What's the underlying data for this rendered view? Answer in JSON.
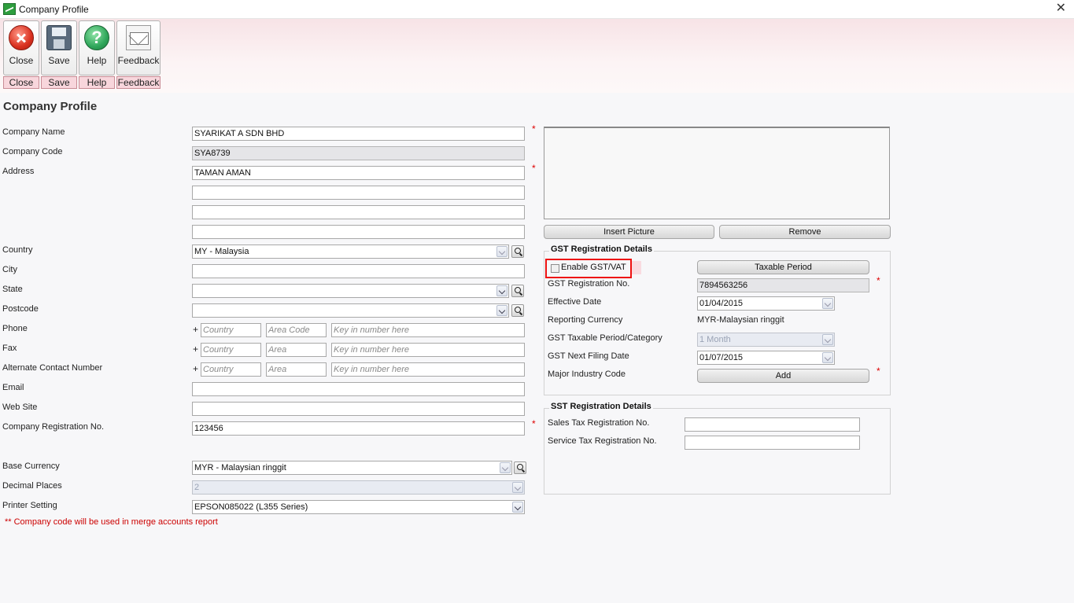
{
  "window": {
    "title": "Company Profile",
    "close_glyph": "✕"
  },
  "toolbar": {
    "buttons": [
      {
        "label": "Close",
        "sub": "Close",
        "icon": "close-icon"
      },
      {
        "label": "Save",
        "sub": "Save",
        "icon": "save-icon"
      },
      {
        "label": "Help",
        "sub": "Help",
        "icon": "help-icon",
        "glyph": "?"
      },
      {
        "label": "Feedback",
        "sub": "Feedback",
        "icon": "feedback-icon"
      }
    ]
  },
  "page_title": "Company Profile",
  "form": {
    "company_name": {
      "label": "Company Name",
      "value": "SYARIKAT A SDN BHD"
    },
    "company_code": {
      "label": "Company Code",
      "value": "SYA8739"
    },
    "address": {
      "label": "Address",
      "line1": "TAMAN AMAN",
      "line2": "",
      "line3": "",
      "line4": ""
    },
    "country": {
      "label": "Country",
      "value": "MY - Malaysia"
    },
    "city": {
      "label": "City",
      "value": ""
    },
    "state": {
      "label": "State",
      "value": ""
    },
    "postcode": {
      "label": "Postcode",
      "value": ""
    },
    "phone": {
      "label": "Phone",
      "plus": "+",
      "country_ph": "Country",
      "area_ph": "Area Code",
      "number_ph": "Key in number here"
    },
    "fax": {
      "label": "Fax",
      "plus": "+",
      "country_ph": "Country",
      "area_ph": "Area",
      "number_ph": "Key in number here"
    },
    "alt_contact": {
      "label": "Alternate Contact Number",
      "plus": "+",
      "country_ph": "Country",
      "area_ph": "Area",
      "number_ph": "Key in number here"
    },
    "email": {
      "label": "Email",
      "value": ""
    },
    "website": {
      "label": "Web Site",
      "value": ""
    },
    "registration_no": {
      "label": "Company Registration No.",
      "value": "123456"
    },
    "base_currency": {
      "label": "Base Currency",
      "value": "MYR - Malaysian ringgit"
    },
    "decimal_places": {
      "label": "Decimal Places",
      "value": "2"
    },
    "printer_setting": {
      "label": "Printer Setting",
      "value": "EPSON085022 (L355 Series)"
    },
    "required_mark": "*"
  },
  "picture": {
    "insert_label": "Insert Picture",
    "remove_label": "Remove"
  },
  "gst": {
    "title": "GST Registration Details",
    "enable_label": "Enable GST/VAT",
    "enable_checked": false,
    "taxable_period_button": "Taxable Period",
    "reg_no": {
      "label": "GST Registration No.",
      "value": "7894563256"
    },
    "effective_date": {
      "label": "Effective Date",
      "value": "01/04/2015"
    },
    "reporting_currency": {
      "label": "Reporting Currency",
      "value": "MYR-Malaysian ringgit"
    },
    "taxable_period": {
      "label": "GST Taxable Period/Category",
      "value": "1 Month"
    },
    "next_filing": {
      "label": "GST Next Filing Date",
      "value": "01/07/2015"
    },
    "industry_code": {
      "label": "Major Industry Code",
      "button": "Add"
    }
  },
  "sst": {
    "title": "SST Registration Details",
    "sales": {
      "label": "Sales Tax Registration No.",
      "value": ""
    },
    "service": {
      "label": "Service Tax Registration No.",
      "value": ""
    }
  },
  "note": "** Company code will be used in merge accounts report"
}
